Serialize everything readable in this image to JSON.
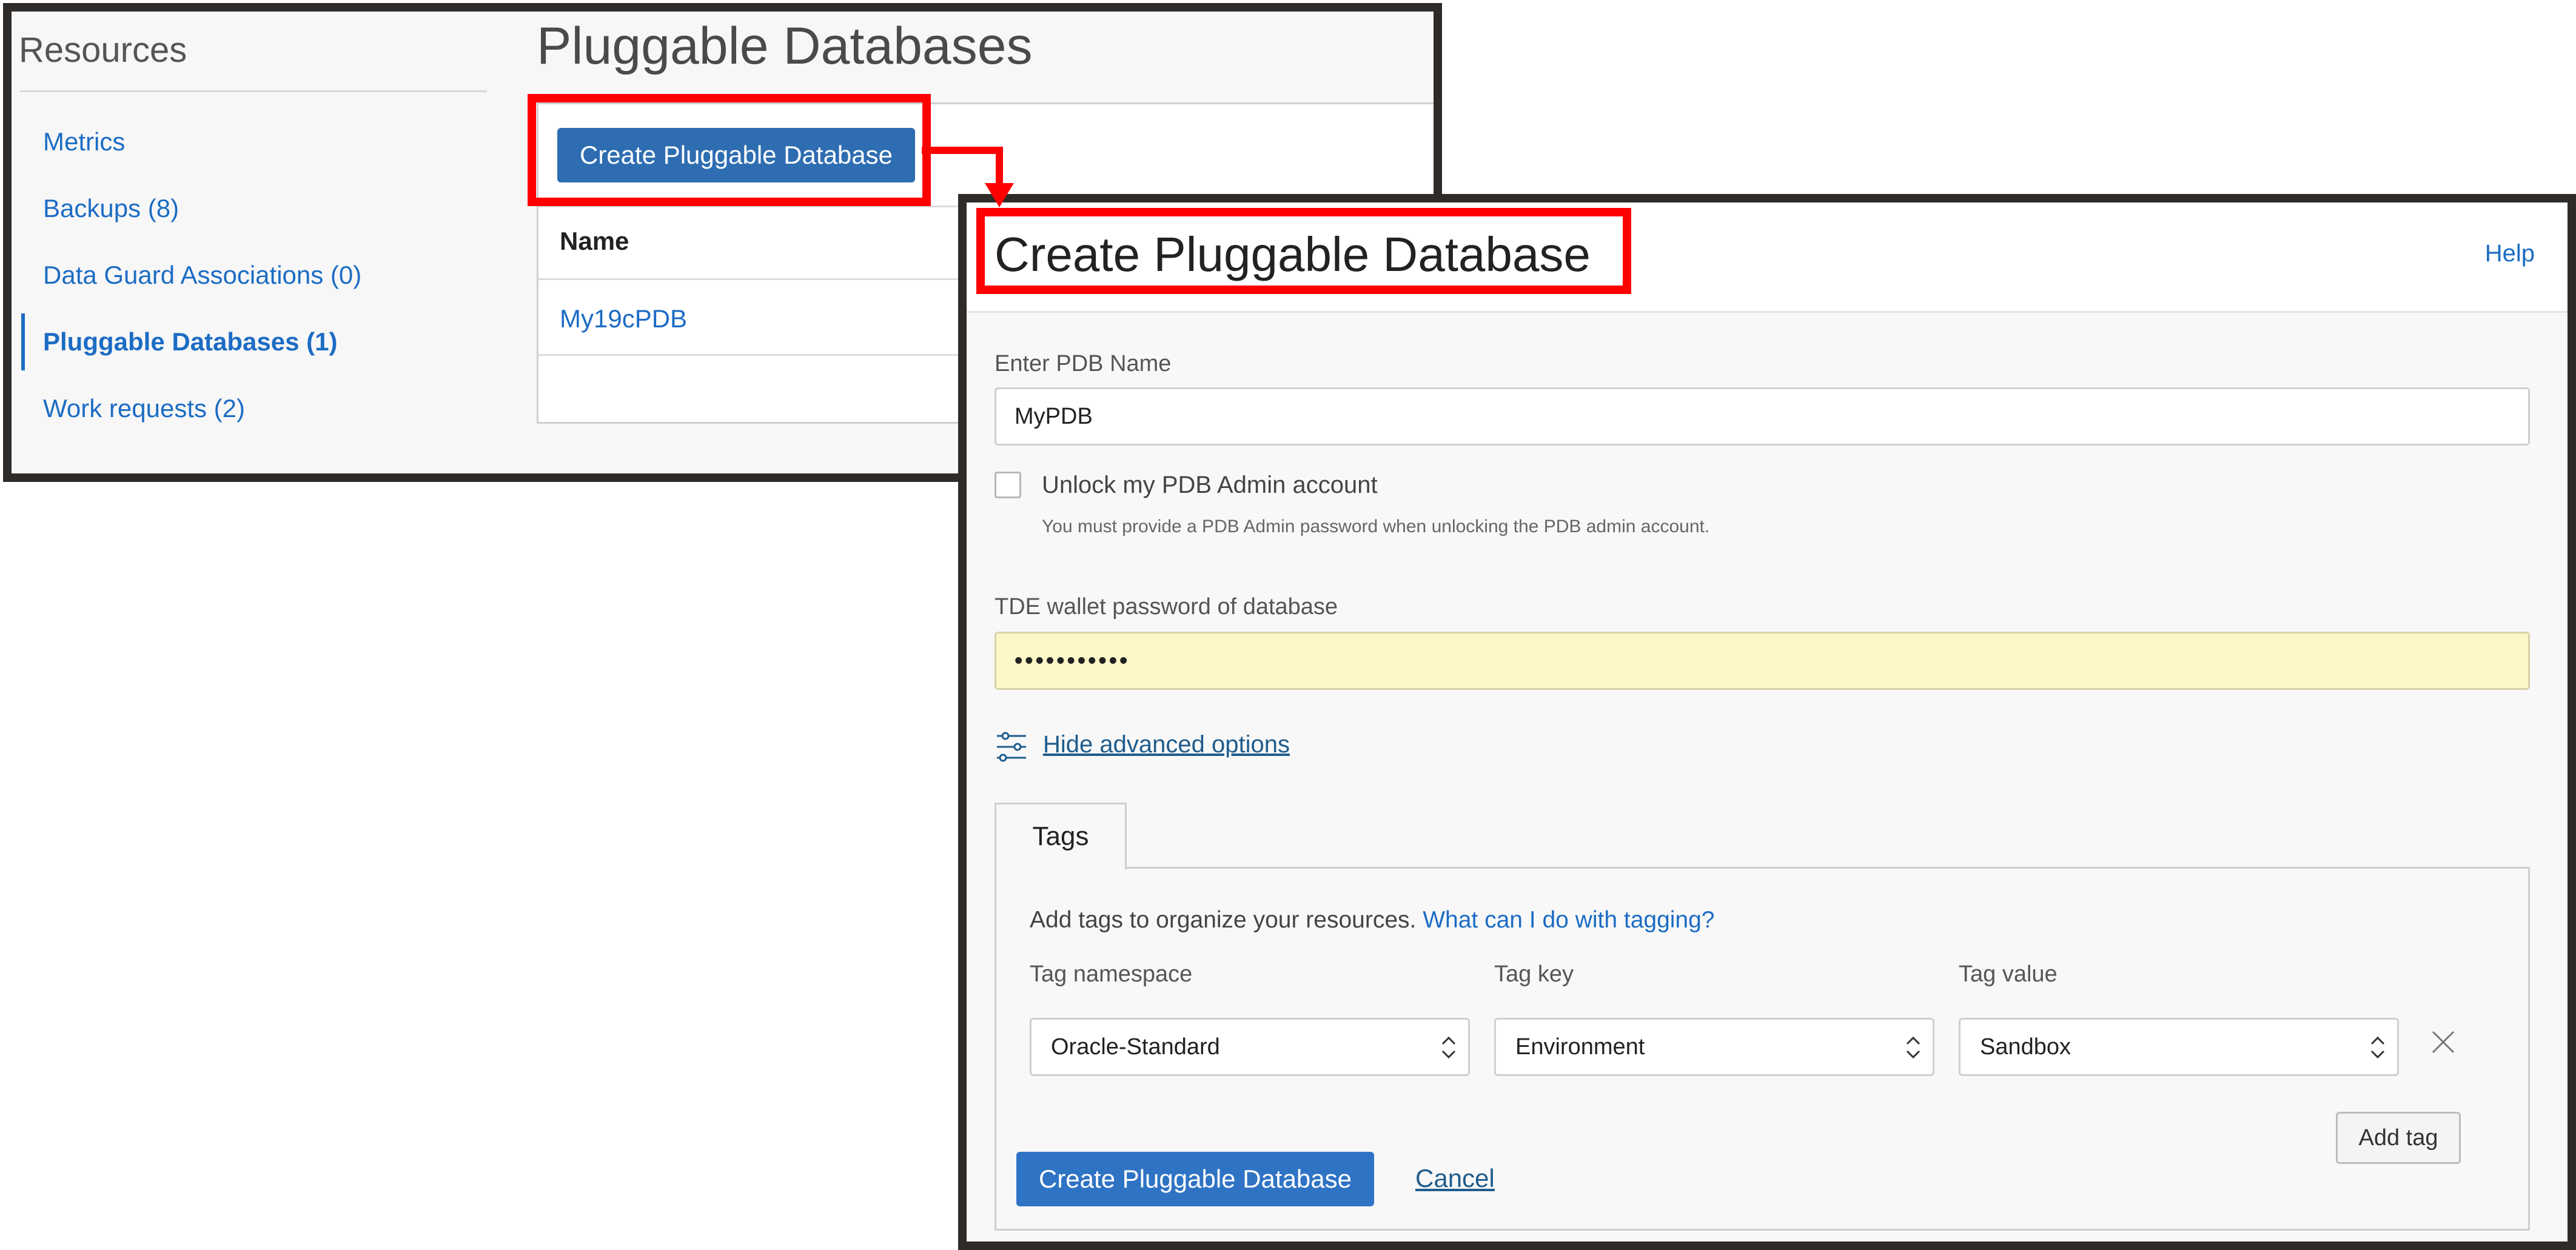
{
  "background_panel": {
    "resources_title": "Resources",
    "nav_items": [
      {
        "label": "Metrics",
        "active": false
      },
      {
        "label": "Backups (8)",
        "active": false
      },
      {
        "label": "Data Guard Associations (0)",
        "active": false
      },
      {
        "label": "Pluggable Databases (1)",
        "active": true
      },
      {
        "label": "Work requests (2)",
        "active": false
      }
    ],
    "page_title": "Pluggable Databases",
    "create_button_label": "Create Pluggable Database",
    "table": {
      "column_header": "Name",
      "rows": [
        "My19cPDB"
      ]
    }
  },
  "dialog": {
    "title": "Create Pluggable Database",
    "help_label": "Help",
    "pdb_name": {
      "label": "Enter PDB Name",
      "value": "MyPDB"
    },
    "unlock_admin": {
      "label": "Unlock my PDB Admin account",
      "checked": false,
      "help": "You must provide a PDB Admin password when unlocking the PDB admin account."
    },
    "tde_password": {
      "label": "TDE wallet password of database",
      "value": "•••••••••••"
    },
    "advanced_link": "Hide advanced options",
    "tags": {
      "tab_label": "Tags",
      "intro": "Add tags to organize your resources.",
      "intro_link": "What can I do with tagging?",
      "namespace_label": "Tag namespace",
      "key_label": "Tag key",
      "value_label": "Tag value",
      "namespace_value": "Oracle-Standard",
      "key_value": "Environment",
      "value_value": "Sandbox",
      "add_tag_label": "Add tag"
    },
    "submit_label": "Create Pluggable Database",
    "cancel_label": "Cancel"
  },
  "colors": {
    "accent_blue": "#1c6cc4",
    "primary_button": "#2e6db1",
    "highlight_red": "#ff0000",
    "frame_dark": "#2f2b28",
    "tde_field_bg": "#fef7c7"
  },
  "icons": [
    "advanced-options-sliders-icon",
    "select-chevron-icon",
    "remove-tag-x-icon",
    "connector-arrow-icon"
  ]
}
